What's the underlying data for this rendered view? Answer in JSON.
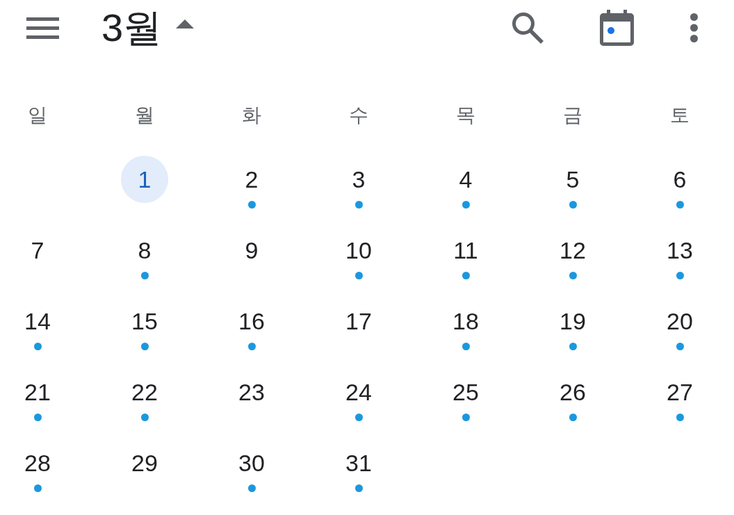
{
  "header": {
    "title": "3월"
  },
  "weekdays": [
    "일",
    "월",
    "화",
    "수",
    "목",
    "금",
    "토"
  ],
  "weeks": [
    {
      "days": [
        {
          "kind": "blank"
        },
        {
          "kind": "date",
          "label": "1",
          "selected": true,
          "has_event": false
        },
        {
          "kind": "date",
          "label": "2",
          "selected": false,
          "has_event": true
        },
        {
          "kind": "date",
          "label": "3",
          "selected": false,
          "has_event": true
        },
        {
          "kind": "date",
          "label": "4",
          "selected": false,
          "has_event": true
        },
        {
          "kind": "date",
          "label": "5",
          "selected": false,
          "has_event": true
        },
        {
          "kind": "date",
          "label": "6",
          "selected": false,
          "has_event": true
        }
      ]
    },
    {
      "days": [
        {
          "kind": "date",
          "label": "7",
          "selected": false,
          "has_event": false
        },
        {
          "kind": "date",
          "label": "8",
          "selected": false,
          "has_event": true
        },
        {
          "kind": "date",
          "label": "9",
          "selected": false,
          "has_event": false
        },
        {
          "kind": "date",
          "label": "10",
          "selected": false,
          "has_event": true
        },
        {
          "kind": "date",
          "label": "11",
          "selected": false,
          "has_event": true
        },
        {
          "kind": "date",
          "label": "12",
          "selected": false,
          "has_event": true
        },
        {
          "kind": "date",
          "label": "13",
          "selected": false,
          "has_event": true
        }
      ]
    },
    {
      "days": [
        {
          "kind": "date",
          "label": "14",
          "selected": false,
          "has_event": true
        },
        {
          "kind": "date",
          "label": "15",
          "selected": false,
          "has_event": true
        },
        {
          "kind": "date",
          "label": "16",
          "selected": false,
          "has_event": true
        },
        {
          "kind": "date",
          "label": "17",
          "selected": false,
          "has_event": false
        },
        {
          "kind": "date",
          "label": "18",
          "selected": false,
          "has_event": true
        },
        {
          "kind": "date",
          "label": "19",
          "selected": false,
          "has_event": true
        },
        {
          "kind": "date",
          "label": "20",
          "selected": false,
          "has_event": true
        }
      ]
    },
    {
      "days": [
        {
          "kind": "date",
          "label": "21",
          "selected": false,
          "has_event": true
        },
        {
          "kind": "date",
          "label": "22",
          "selected": false,
          "has_event": true
        },
        {
          "kind": "date",
          "label": "23",
          "selected": false,
          "has_event": false
        },
        {
          "kind": "date",
          "label": "24",
          "selected": false,
          "has_event": true
        },
        {
          "kind": "date",
          "label": "25",
          "selected": false,
          "has_event": true
        },
        {
          "kind": "date",
          "label": "26",
          "selected": false,
          "has_event": true
        },
        {
          "kind": "date",
          "label": "27",
          "selected": false,
          "has_event": true
        }
      ]
    },
    {
      "days": [
        {
          "kind": "date",
          "label": "28",
          "selected": false,
          "has_event": true
        },
        {
          "kind": "date",
          "label": "29",
          "selected": false,
          "has_event": false
        },
        {
          "kind": "date",
          "label": "30",
          "selected": false,
          "has_event": true
        },
        {
          "kind": "date",
          "label": "31",
          "selected": false,
          "has_event": true
        }
      ]
    }
  ]
}
